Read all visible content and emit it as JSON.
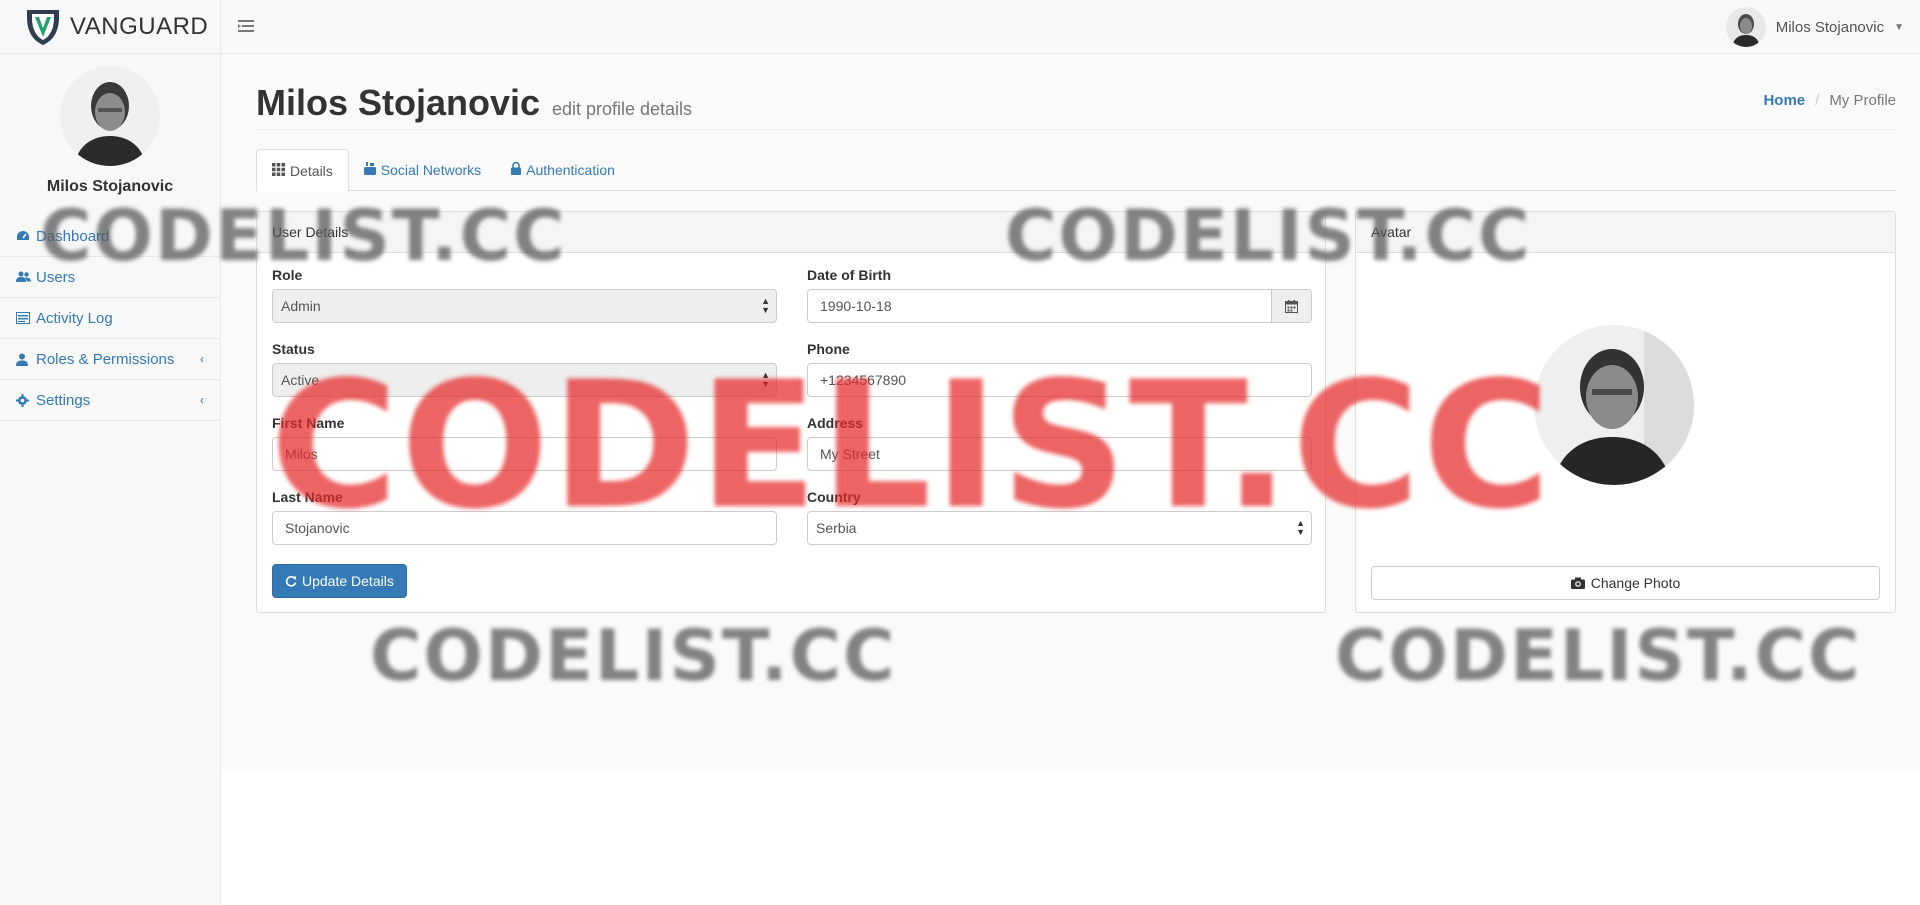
{
  "brand": {
    "name": "VANGUARD"
  },
  "topbar": {
    "user_name": "Milos Stojanovic"
  },
  "sidebar": {
    "user_name": "Milos Stojanovic",
    "items": [
      {
        "label": "Dashboard",
        "icon": "dashboard-icon"
      },
      {
        "label": "Users",
        "icon": "users-icon"
      },
      {
        "label": "Activity Log",
        "icon": "list-icon"
      },
      {
        "label": "Roles & Permissions",
        "icon": "user-icon"
      },
      {
        "label": "Settings",
        "icon": "gear-icon"
      }
    ]
  },
  "page": {
    "title": "Milos Stojanovic",
    "subtitle": "edit profile details",
    "breadcrumb": {
      "home": "Home",
      "current": "My Profile"
    }
  },
  "tabs": [
    {
      "label": "Details",
      "active": true
    },
    {
      "label": "Social Networks",
      "active": false
    },
    {
      "label": "Authentication",
      "active": false
    }
  ],
  "user_details": {
    "heading": "User Details",
    "role": {
      "label": "Role",
      "value": "Admin"
    },
    "dob": {
      "label": "Date of Birth",
      "value": "1990-10-18"
    },
    "status": {
      "label": "Status",
      "value": "Active"
    },
    "phone": {
      "label": "Phone",
      "value": "+1234567890"
    },
    "first_name": {
      "label": "First Name",
      "value": "Milos"
    },
    "address": {
      "label": "Address",
      "value": "My Street"
    },
    "last_name": {
      "label": "Last Name",
      "value": "Stojanovic"
    },
    "country": {
      "label": "Country",
      "value": "Serbia"
    },
    "update_button": "Update Details"
  },
  "avatar_panel": {
    "heading": "Avatar",
    "change_button": "Change Photo"
  },
  "watermarks": {
    "text": "CODELIST.CC"
  },
  "colors": {
    "accent": "#337ab7",
    "watermark_red": "#e62828",
    "watermark_gray": "#5a5a5a"
  }
}
